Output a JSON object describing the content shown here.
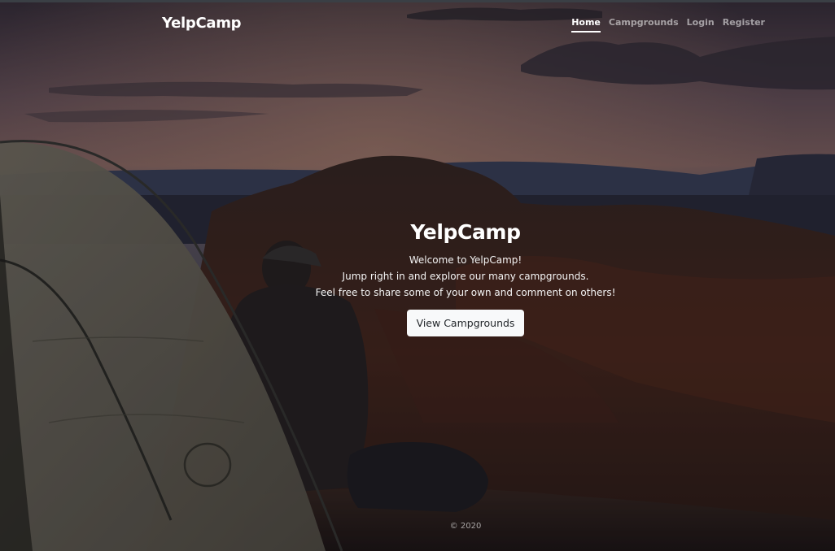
{
  "navbar": {
    "brand": "YelpCamp",
    "links": [
      {
        "label": "Home",
        "active": true
      },
      {
        "label": "Campgrounds",
        "active": false
      },
      {
        "label": "Login",
        "active": false
      },
      {
        "label": "Register",
        "active": false
      }
    ]
  },
  "hero": {
    "title": "YelpCamp",
    "lines": [
      "Welcome to YelpCamp!",
      "Jump right in and explore our many campgrounds.",
      "Feel free to share some of your own and comment on others!"
    ],
    "button_label": "View Campgrounds"
  },
  "footer": {
    "copyright": "© 2020"
  },
  "colors": {
    "button_bg": "#f8f9fa",
    "button_text": "#212529",
    "nav_active": "#ffffff"
  }
}
